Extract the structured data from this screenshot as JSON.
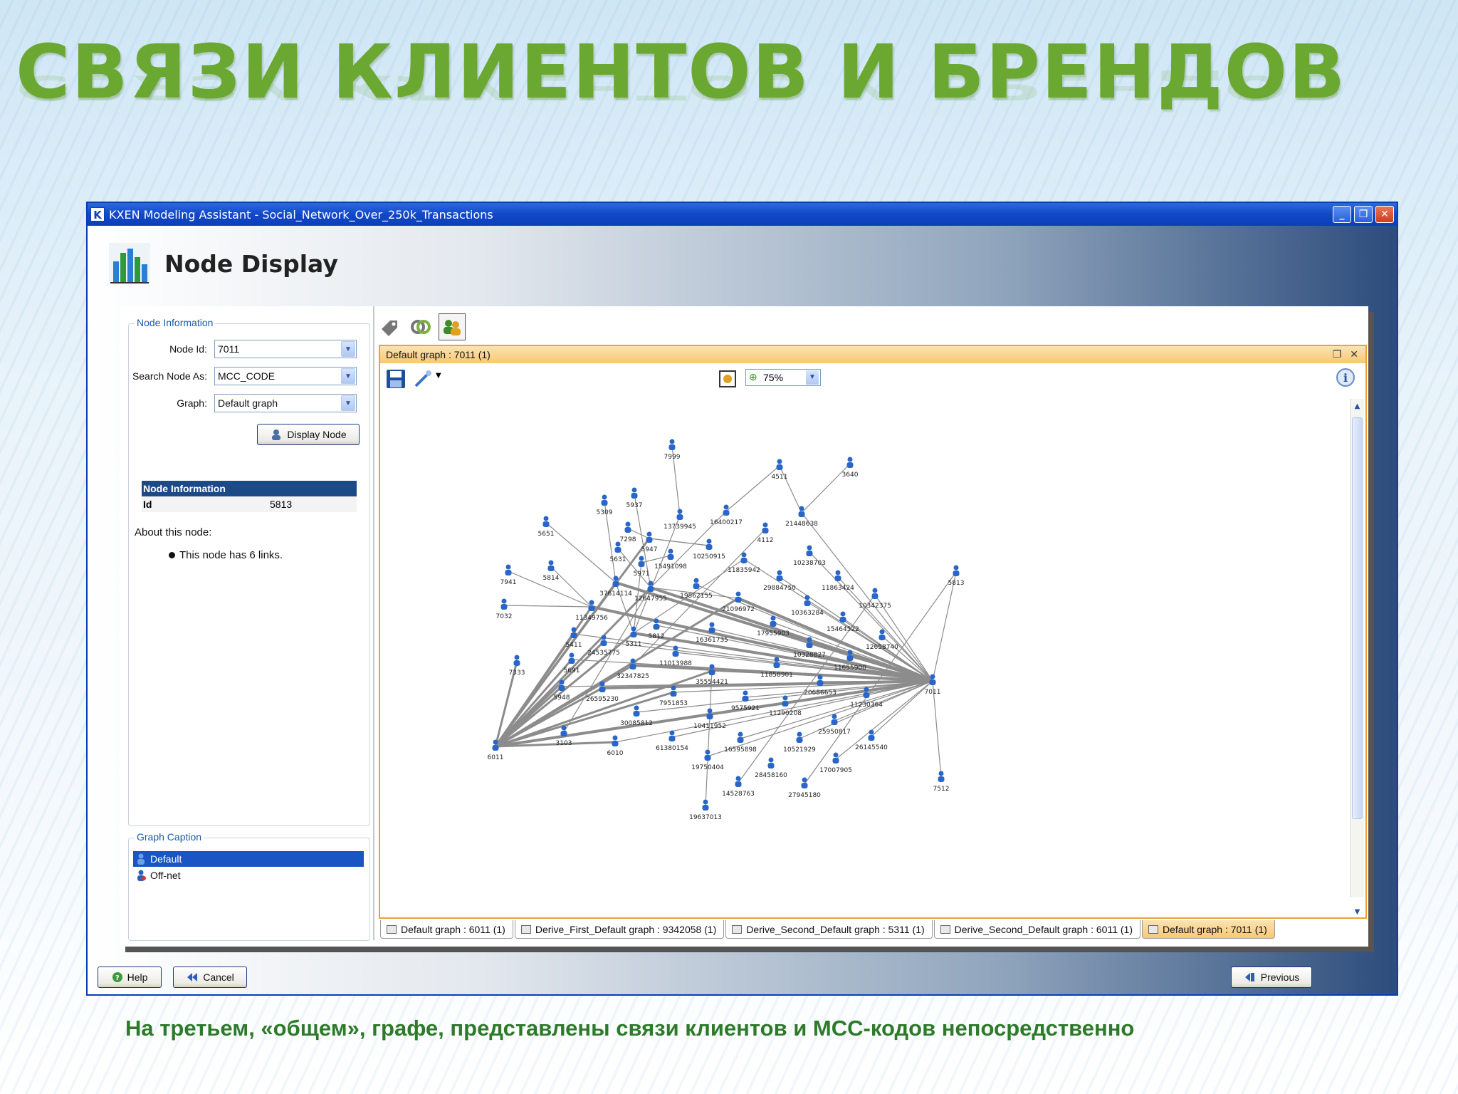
{
  "slide": {
    "title": "СВЯЗИ КЛИЕНТОВ И БРЕНДОВ",
    "caption": "На третьем, «общем», графе, представлены связи клиентов и МСС-кодов непосредственно"
  },
  "window": {
    "title": "KXEN Modeling Assistant - Social_Network_Over_250k_Transactions",
    "app_icon_letter": "K",
    "page_title": "Node Display"
  },
  "left_panel": {
    "group_title": "Node Information",
    "fields": [
      {
        "label": "Node Id:",
        "value": "7011"
      },
      {
        "label": "Search Node As:",
        "value": "MCC_CODE"
      },
      {
        "label": "Graph:",
        "value": "Default graph"
      }
    ],
    "display_button": "Display Node",
    "info_table": {
      "header": "Node Information",
      "key": "Id",
      "value": "5813"
    },
    "about_label": "About this node:",
    "about_bullet": "This node has 6 links.",
    "caption_group_title": "Graph Caption",
    "caption_items": [
      {
        "label": "Default",
        "selected": true
      },
      {
        "label": "Off-net",
        "selected": false
      }
    ]
  },
  "graph_window": {
    "title": "Default graph : 7011 (1)",
    "zoom": "75%",
    "tabs": [
      {
        "label": "Default graph : 6011 (1)",
        "active": false
      },
      {
        "label": "Derive_First_Default graph : 9342058 (1)",
        "active": false
      },
      {
        "label": "Derive_Second_Default graph : 5311 (1)",
        "active": false
      },
      {
        "label": "Derive_Second_Default graph : 6011 (1)",
        "active": false
      },
      {
        "label": "Default graph : 7011 (1)",
        "active": true
      }
    ],
    "nodes": [
      "7999",
      "4511",
      "3640",
      "5309",
      "5937",
      "13739945",
      "16400217",
      "21448638",
      "5651",
      "7298",
      "5947",
      "4112",
      "5631",
      "10250915",
      "15491098",
      "11835942",
      "10238703",
      "7941",
      "5814",
      "5971",
      "29884750",
      "11863424",
      "5813",
      "37614114",
      "12647955",
      "19862155",
      "21096972",
      "10363284",
      "10342375",
      "7032",
      "11349756",
      "15464522",
      "17955903",
      "5812",
      "16361735",
      "12658740",
      "5411",
      "5311",
      "24535775",
      "10328827",
      "11655900",
      "7333",
      "5691",
      "11013988",
      "11858901",
      "7011",
      "32347825",
      "35554421",
      "20686653",
      "5948",
      "26595230",
      "7951853",
      "9575921",
      "11230364",
      "11290208",
      "30085812",
      "10411952",
      "25950817",
      "3103",
      "6010",
      "61380154",
      "16595898",
      "10521929",
      "26145540",
      "6011",
      "19750404",
      "28458160",
      "17007905",
      "14528763",
      "27945180",
      "7512",
      "19637013"
    ]
  },
  "bottom_buttons": {
    "help": "Help",
    "cancel": "Cancel",
    "previous": "Previous"
  }
}
